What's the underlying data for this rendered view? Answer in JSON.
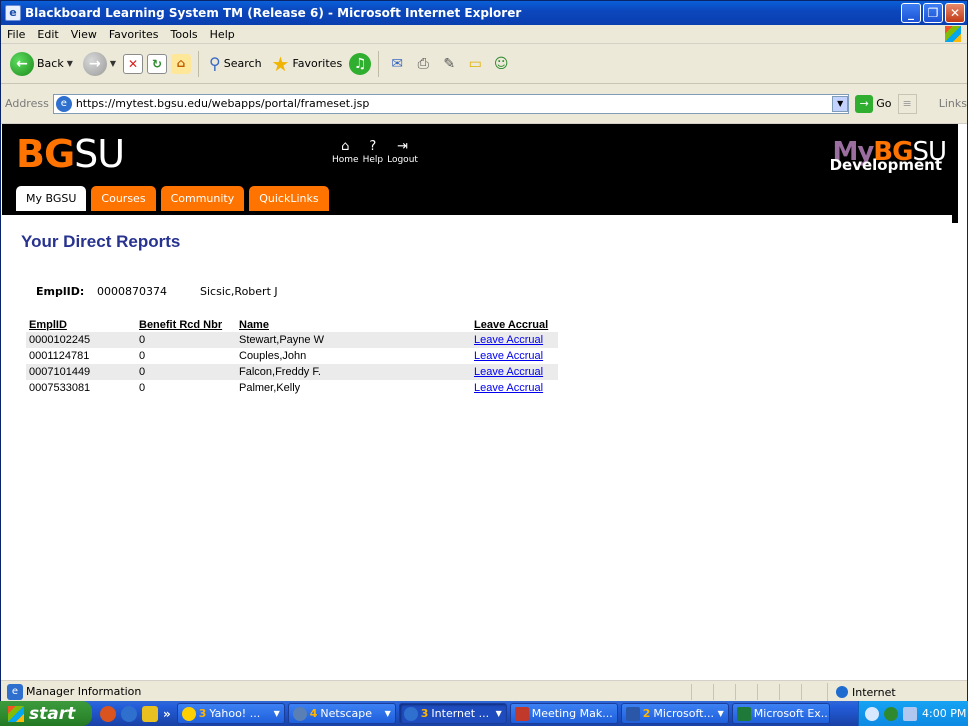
{
  "window": {
    "title": "Blackboard Learning System TM (Release 6) - Microsoft Internet Explorer"
  },
  "menu": [
    "File",
    "Edit",
    "View",
    "Favorites",
    "Tools",
    "Help"
  ],
  "toolbar": {
    "back_label": "Back",
    "search_label": "Search",
    "favorites_label": "Favorites"
  },
  "address": {
    "label": "Address",
    "url": "https://mytest.bgsu.edu/webapps/portal/frameset.jsp",
    "go_label": "Go",
    "links_label": "Links"
  },
  "header": {
    "logo_bg": "BG",
    "logo_su": "SU",
    "nav": [
      {
        "label": "Home",
        "icon": "home-icon"
      },
      {
        "label": "Help",
        "icon": "help-icon"
      },
      {
        "label": "Logout",
        "icon": "logout-icon"
      }
    ],
    "brand_my": "My",
    "brand_bg": "BG",
    "brand_su": "SU",
    "brand_sub": "Development",
    "tabs": [
      "My BGSU",
      "Courses",
      "Community",
      "QuickLinks"
    ]
  },
  "page": {
    "title": "Your Direct Reports",
    "empl_label": "EmplID:",
    "empl_id": "0000870374",
    "empl_name": "Sicsic,Robert J",
    "columns": [
      "EmplID",
      "Benefit Rcd Nbr",
      "Name",
      "Leave Accrual"
    ],
    "rows": [
      {
        "emplid": "0000102245",
        "rcd": "0",
        "name": "Stewart,Payne W",
        "link": "Leave Accrual"
      },
      {
        "emplid": "0001124781",
        "rcd": "0",
        "name": "Couples,John",
        "link": "Leave Accrual"
      },
      {
        "emplid": "0007101449",
        "rcd": "0",
        "name": "Falcon,Freddy F.",
        "link": "Leave Accrual"
      },
      {
        "emplid": "0007533081",
        "rcd": "0",
        "name": "Palmer,Kelly",
        "link": "Leave Accrual"
      }
    ]
  },
  "status": {
    "text": "Manager Information",
    "zone": "Internet"
  },
  "taskbar": {
    "start": "start",
    "tasks": [
      {
        "num": "3",
        "label": "Yahoo! ..."
      },
      {
        "num": "4",
        "label": "Netscape"
      },
      {
        "num": "3",
        "label": "Internet ..."
      },
      {
        "num": "",
        "label": "Meeting Mak..."
      },
      {
        "num": "2",
        "label": "Microsoft..."
      },
      {
        "num": "",
        "label": "Microsoft Ex..."
      }
    ],
    "clock": "4:00 PM"
  }
}
